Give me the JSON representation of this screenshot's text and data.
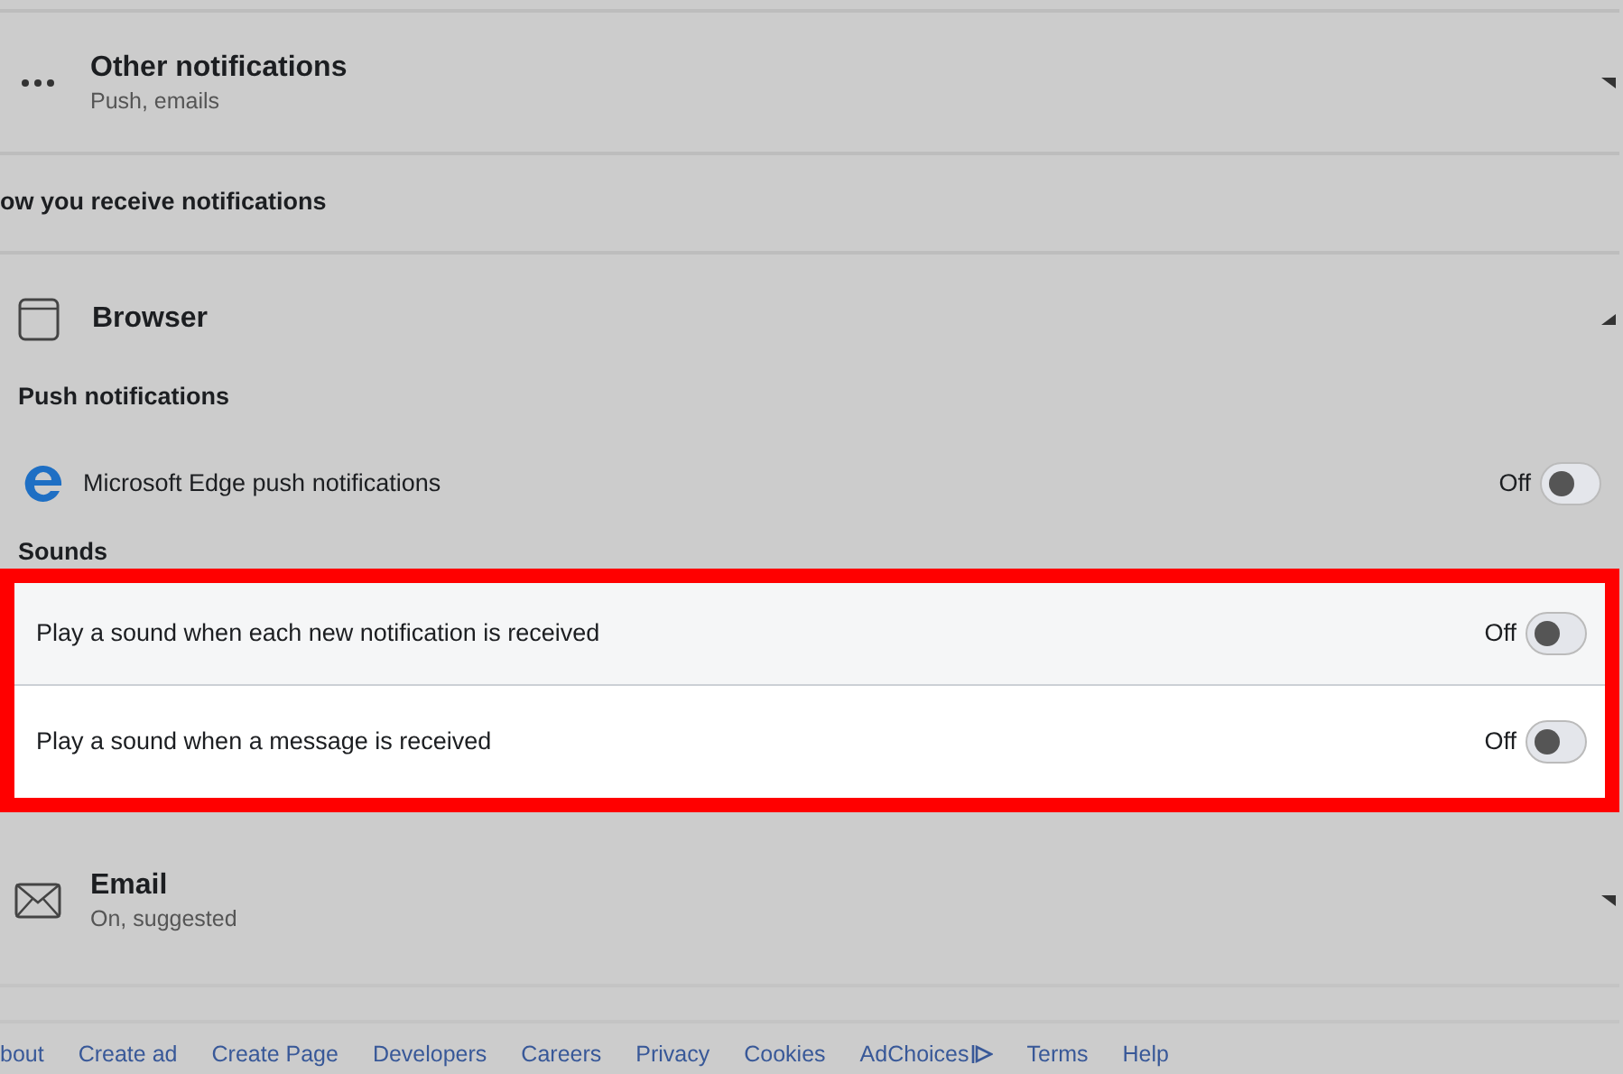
{
  "other_notifications": {
    "title": "Other notifications",
    "subtitle": "Push, emails",
    "expanded": false
  },
  "section_heading": "ow you receive notifications",
  "browser": {
    "title": "Browser",
    "expanded": true,
    "push_heading": "Push notifications",
    "push_items": [
      {
        "label": "Microsoft Edge push notifications",
        "state_label": "Off",
        "on": false
      }
    ],
    "sounds_heading": "Sounds",
    "sound_items": [
      {
        "label": "Play a sound when each new notification is received",
        "state_label": "Off",
        "on": false
      },
      {
        "label": "Play a sound when a message is received",
        "state_label": "Off",
        "on": false
      }
    ]
  },
  "email": {
    "title": "Email",
    "subtitle": "On, suggested",
    "expanded": false
  },
  "footer_links": [
    "bout",
    "Create ad",
    "Create Page",
    "Developers",
    "Careers",
    "Privacy",
    "Cookies",
    "AdChoices",
    "Terms",
    "Help"
  ]
}
